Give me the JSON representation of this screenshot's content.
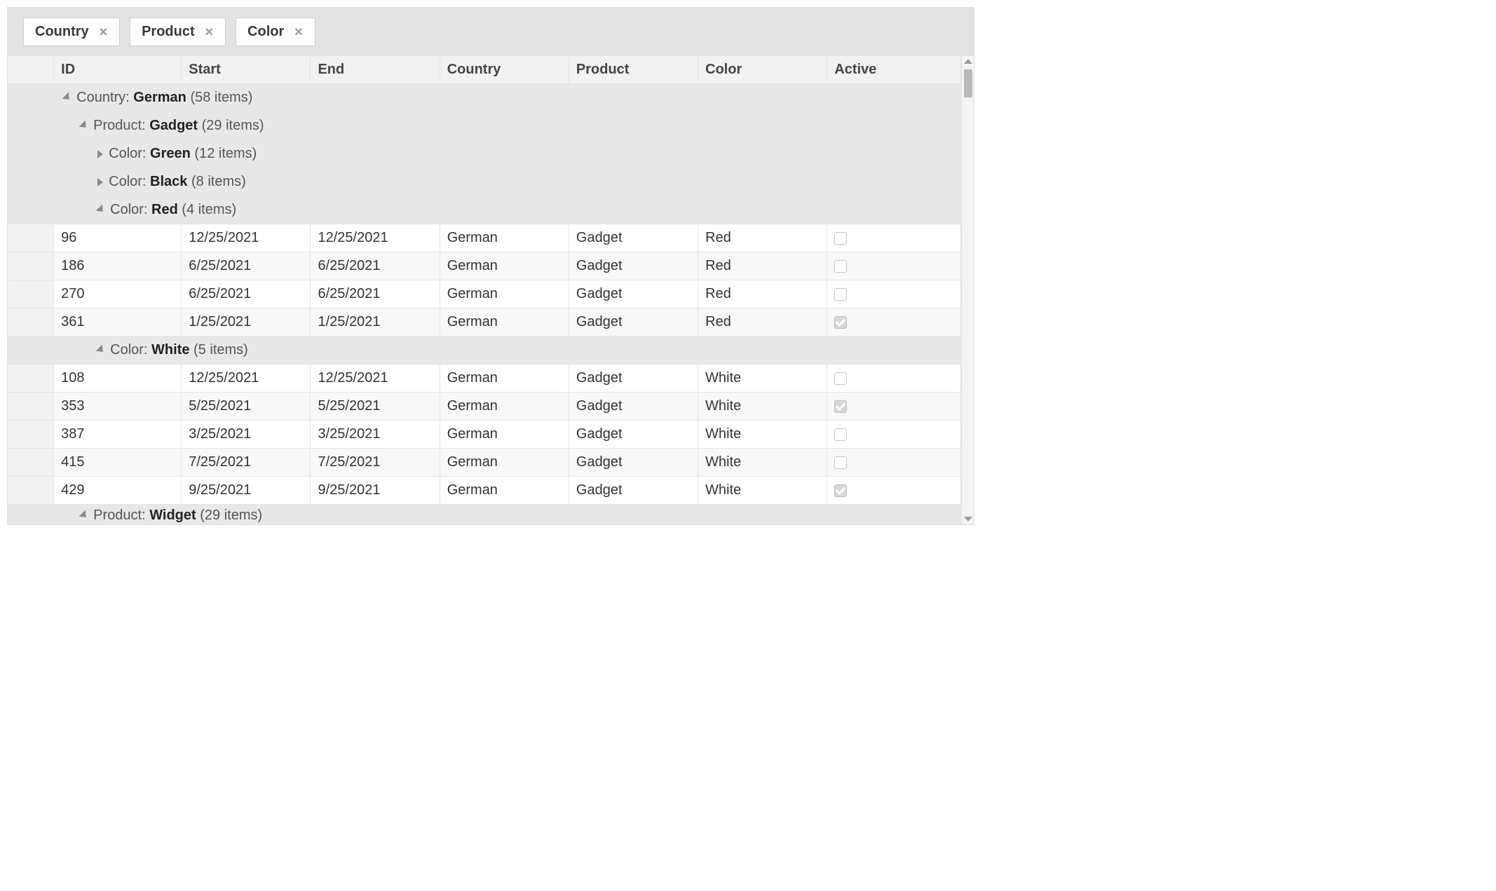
{
  "group_chips": [
    {
      "label": "Country"
    },
    {
      "label": "Product"
    },
    {
      "label": "Color"
    }
  ],
  "columns": {
    "id": "ID",
    "start": "Start",
    "end": "End",
    "country": "Country",
    "product": "Product",
    "color": "Color",
    "active": "Active"
  },
  "groups": {
    "country_label": "Country:",
    "country_value": "German",
    "country_count": "(58 items)",
    "product_gadget_label": "Product:",
    "product_gadget_value": "Gadget",
    "product_gadget_count": "(29 items)",
    "color_green_label": "Color:",
    "color_green_value": "Green",
    "color_green_count": "(12 items)",
    "color_black_label": "Color:",
    "color_black_value": "Black",
    "color_black_count": "(8 items)",
    "color_red_label": "Color:",
    "color_red_value": "Red",
    "color_red_count": "(4 items)",
    "color_white_label": "Color:",
    "color_white_value": "White",
    "color_white_count": "(5 items)",
    "product_widget_label": "Product:",
    "product_widget_value": "Widget",
    "product_widget_count": "(29 items)"
  },
  "rows_red": [
    {
      "id": "96",
      "start": "12/25/2021",
      "end": "12/25/2021",
      "country": "German",
      "product": "Gadget",
      "color": "Red",
      "active": false
    },
    {
      "id": "186",
      "start": "6/25/2021",
      "end": "6/25/2021",
      "country": "German",
      "product": "Gadget",
      "color": "Red",
      "active": false
    },
    {
      "id": "270",
      "start": "6/25/2021",
      "end": "6/25/2021",
      "country": "German",
      "product": "Gadget",
      "color": "Red",
      "active": false
    },
    {
      "id": "361",
      "start": "1/25/2021",
      "end": "1/25/2021",
      "country": "German",
      "product": "Gadget",
      "color": "Red",
      "active": true
    }
  ],
  "rows_white": [
    {
      "id": "108",
      "start": "12/25/2021",
      "end": "12/25/2021",
      "country": "German",
      "product": "Gadget",
      "color": "White",
      "active": false
    },
    {
      "id": "353",
      "start": "5/25/2021",
      "end": "5/25/2021",
      "country": "German",
      "product": "Gadget",
      "color": "White",
      "active": true
    },
    {
      "id": "387",
      "start": "3/25/2021",
      "end": "3/25/2021",
      "country": "German",
      "product": "Gadget",
      "color": "White",
      "active": false
    },
    {
      "id": "415",
      "start": "7/25/2021",
      "end": "7/25/2021",
      "country": "German",
      "product": "Gadget",
      "color": "White",
      "active": false
    },
    {
      "id": "429",
      "start": "9/25/2021",
      "end": "9/25/2021",
      "country": "German",
      "product": "Gadget",
      "color": "White",
      "active": true
    }
  ]
}
